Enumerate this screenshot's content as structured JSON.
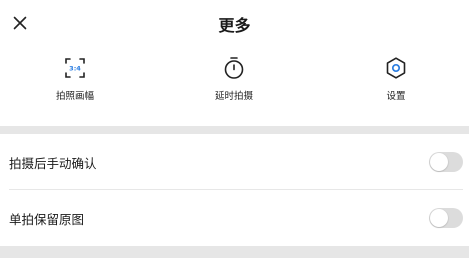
{
  "header": {
    "title": "更多",
    "close_icon": "close-icon"
  },
  "shortcuts": [
    {
      "icon": "aspect-ratio-icon",
      "icon_text": "3:4",
      "label": "拍照画幅"
    },
    {
      "icon": "timer-icon",
      "label": "延时拍摄"
    },
    {
      "icon": "gear-icon",
      "label": "设置"
    }
  ],
  "settings": [
    {
      "label": "拍摄后手动确认",
      "enabled": false
    },
    {
      "label": "单拍保留原图",
      "enabled": false
    }
  ],
  "colors": {
    "background": "#ffffff",
    "band": "#e6e6e6",
    "toggle_off": "#dcdcdc",
    "accent_blue": "#2a7de1"
  }
}
